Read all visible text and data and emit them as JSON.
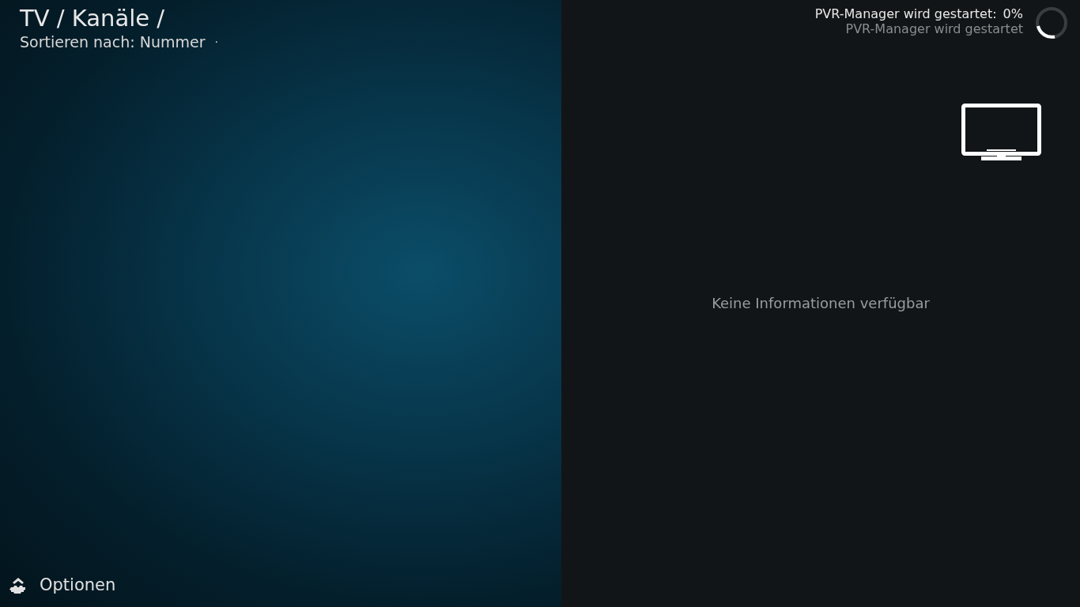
{
  "header": {
    "breadcrumb": "TV / Kanäle /",
    "sort_label": "Sortieren nach: Nummer",
    "separator": "·"
  },
  "status": {
    "title": "PVR-Manager wird gestartet:",
    "percent": "0%",
    "subtitle": "PVR-Manager wird gestartet"
  },
  "info_panel": {
    "message": "Keine Informationen verfügbar"
  },
  "options_button": {
    "label": "Optionen"
  }
}
